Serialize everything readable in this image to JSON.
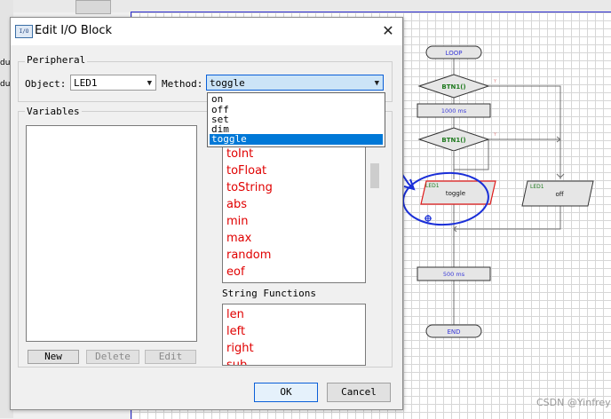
{
  "dialog": {
    "title": "Edit I/O Block",
    "icon_text": "I/O",
    "close_glyph": "✕",
    "peripheral_group": "Peripheral",
    "object_label": "Object:",
    "object_value": "LED1",
    "method_label": "Method:",
    "method_value": "toggle",
    "method_options": [
      "on",
      "off",
      "set",
      "dim",
      "toggle"
    ],
    "variables_group": "Variables",
    "functions_visible": [
      "toInt",
      "toFloat",
      "toString",
      "abs",
      "min",
      "max",
      "random",
      "eof"
    ],
    "string_functions_label": "String Functions",
    "string_functions": [
      "len",
      "left",
      "right",
      "sub"
    ],
    "new_button": "New",
    "delete_button": "Delete",
    "edit_button": "Edit",
    "ok_button": "OK",
    "cancel_button": "Cancel"
  },
  "flowchart": {
    "loop_label": "LOOP",
    "if1_label": "BTN1()",
    "delay1_label": "1000 ms",
    "if2_label": "BTN1()",
    "io_left_device": "LED1",
    "io_left_action": "toggle",
    "io_right_device": "LED1",
    "io_right_action": "off",
    "delay2_label": "500 ms",
    "end_label": "END",
    "yes_mark": "Y"
  },
  "left_strip": [
    "du",
    "du"
  ],
  "watermark": "CSDN @Yinfrey",
  "colors": {
    "flow_text": "#3a3ad8",
    "decision_text": "#1f7a1f",
    "function_text": "#e00000",
    "selection": "#0078d7",
    "annotation_pen": "#1a2fd8"
  },
  "icons": [
    "dialog-app-icon",
    "close-icon",
    "combo-arrow-icon",
    "annotation-arrow",
    "annotation-circle",
    "connector-cross-icon"
  ]
}
